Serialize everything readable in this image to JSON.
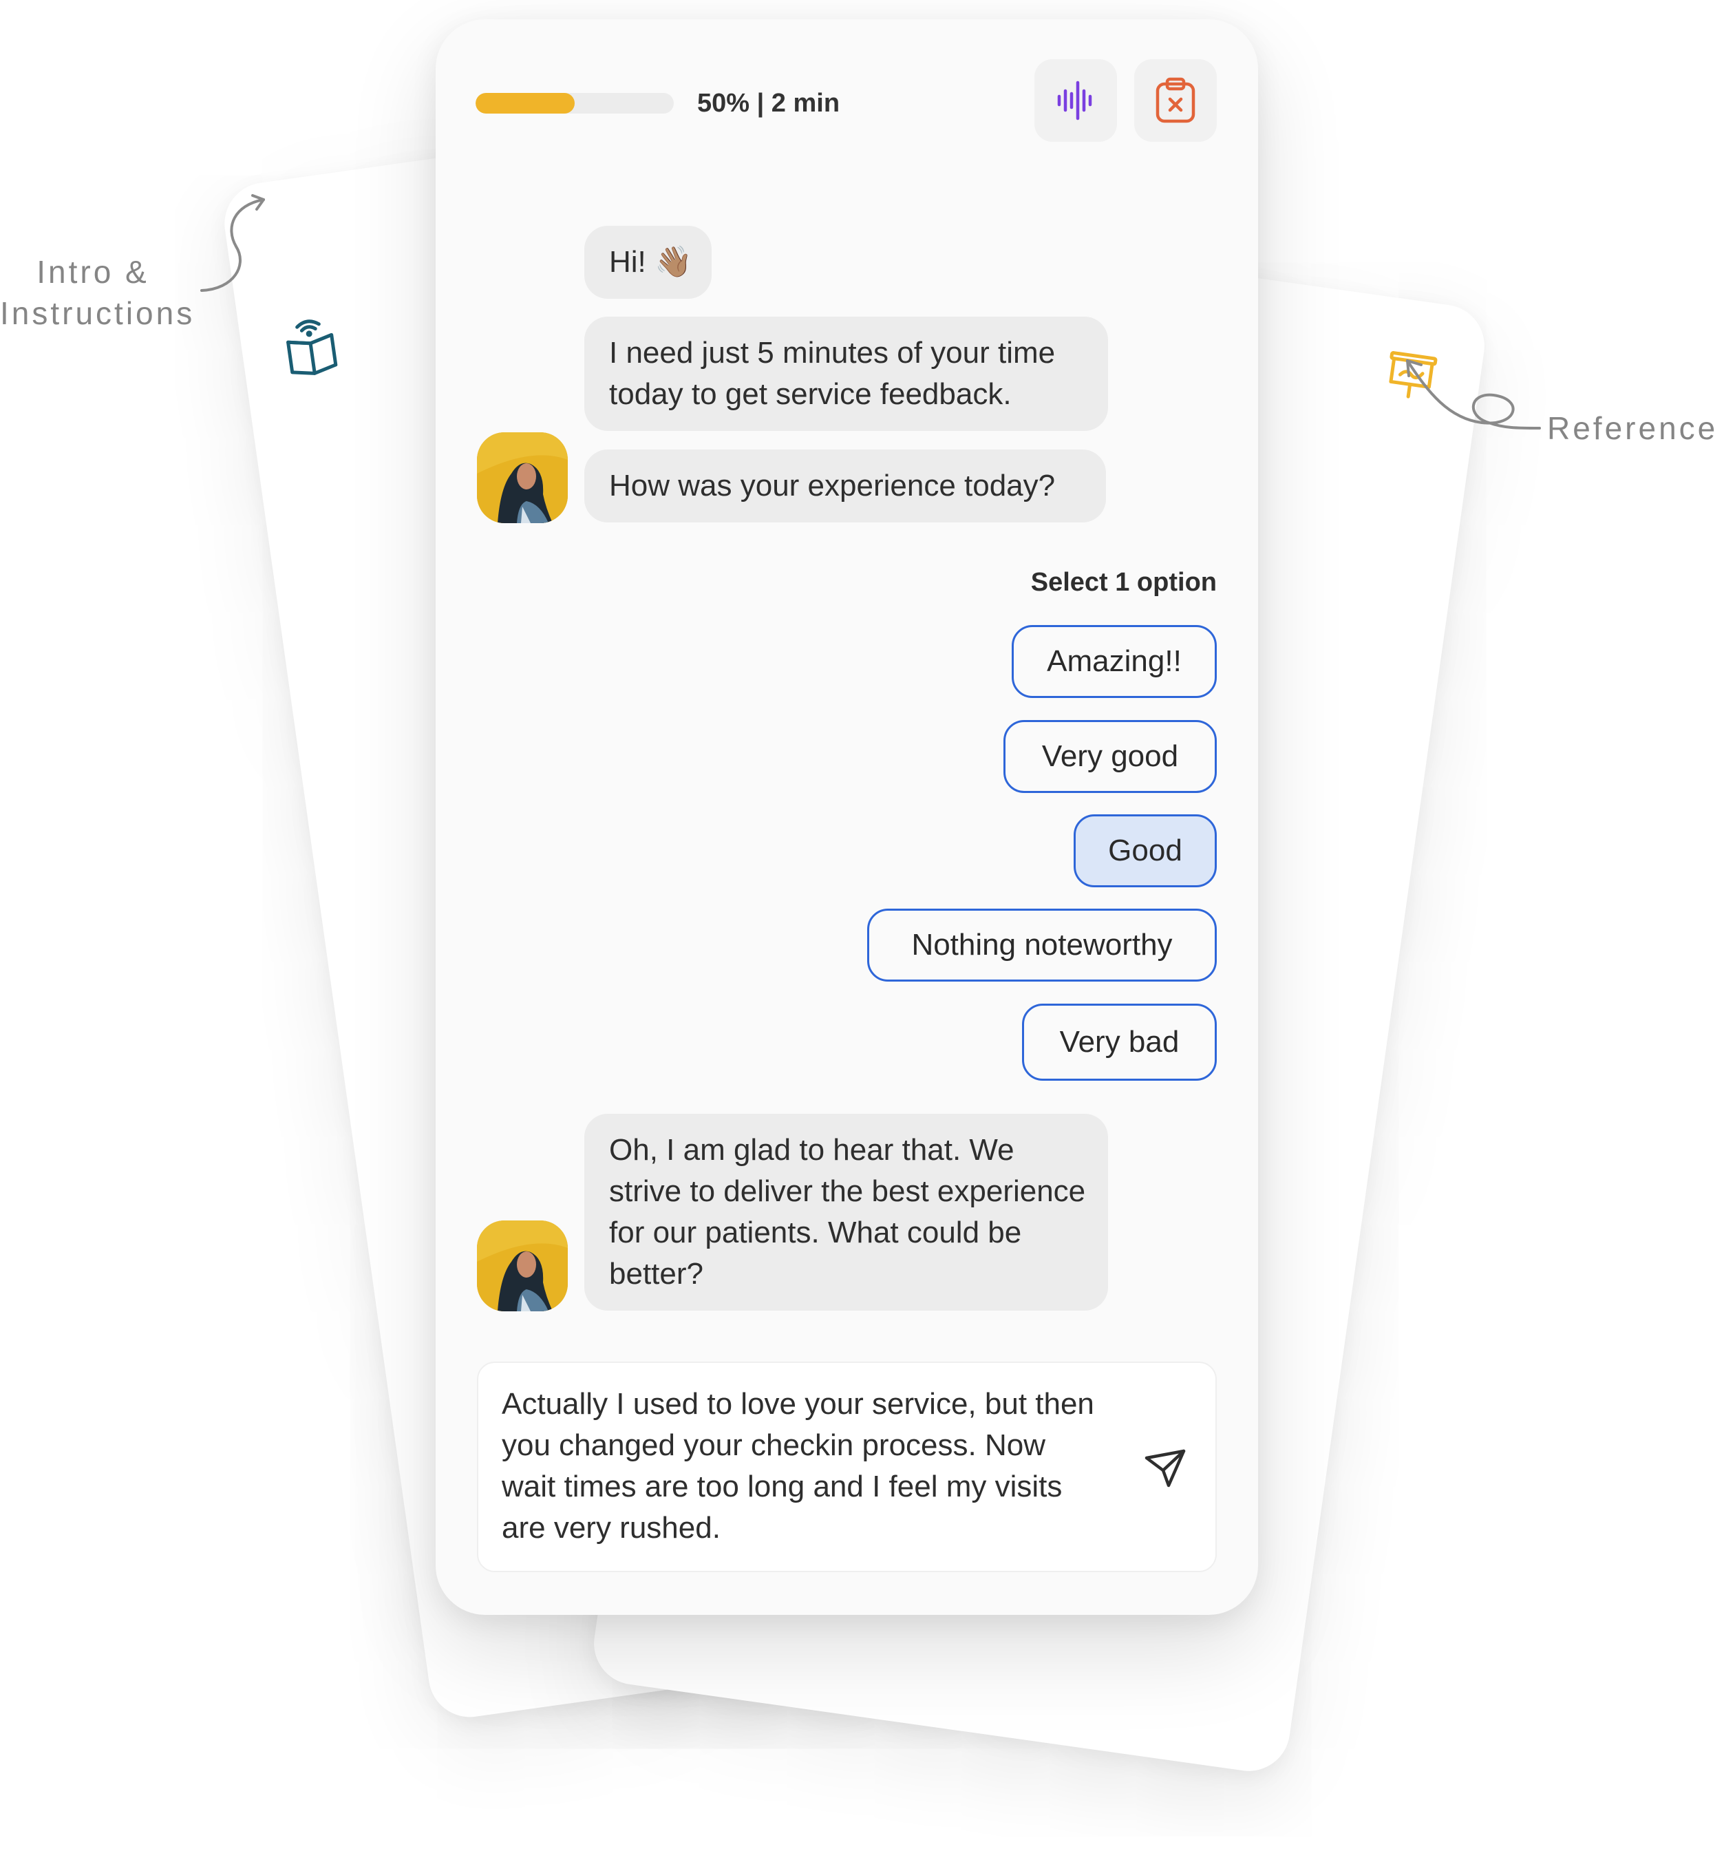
{
  "annotations": {
    "left_line1": "Intro &",
    "left_line2": "Instructions",
    "right": "Reference"
  },
  "header": {
    "progress_percent": 50,
    "progress_label": "50% | 2 min",
    "voice_icon": "sound-wave-icon",
    "exit_icon": "clipboard-x-icon"
  },
  "colors": {
    "progress": "#f0b429",
    "accent_blue": "#2e66d9",
    "voice_purple": "#7a3fe0",
    "exit_orange": "#e2643a",
    "intro_teal": "#1a5d73",
    "reference_yellow": "#f0b429"
  },
  "messages": {
    "greeting": "Hi! 👋🏽",
    "intro": "I need just 5 minutes of your time today to get service feedback.",
    "question": "How was your experience today?",
    "followup": "Oh, I am glad to hear that. We strive to deliver the best experience for our patients. What could be better?"
  },
  "options": {
    "hint": "Select 1 option",
    "items": [
      "Amazing!!",
      "Very good",
      "Good",
      "Nothing noteworthy",
      "Very bad"
    ],
    "selected": "Good"
  },
  "composer": {
    "value": "Actually I used to love your service, but then you changed your checkin process. Now wait times are too long and I feel my visits are very rushed.",
    "send_icon": "send-icon"
  }
}
